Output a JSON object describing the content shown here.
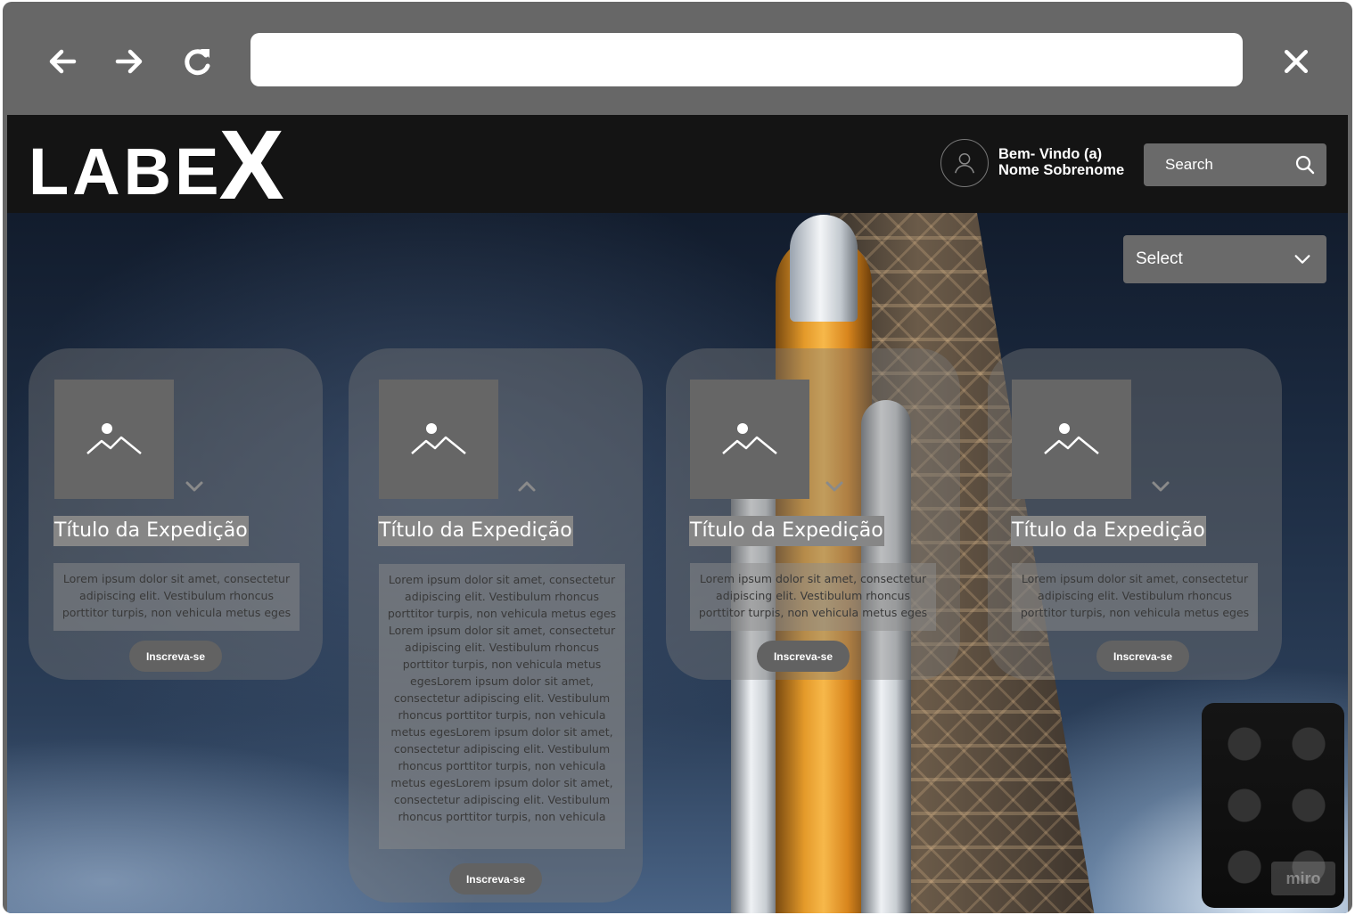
{
  "browser": {
    "url_value": "",
    "icons": {
      "back": "arrow-left-icon",
      "forward": "arrow-right-icon",
      "reload": "reload-icon",
      "close": "close-icon"
    }
  },
  "header": {
    "logo_main": "LABE",
    "logo_accent": "X",
    "welcome_line1": "Bem- Vindo (a)",
    "welcome_line2": "Nome Sobrenome",
    "search_placeholder": "Search"
  },
  "filter": {
    "select_label": "Select"
  },
  "cards": [
    {
      "title": "Título da Expedição",
      "caret": "down",
      "description": "Lorem ipsum dolor sit amet, consectetur adipiscing elit. Vestibulum rhoncus porttitor turpis, non vehicula metus eges",
      "button": "Inscreva-se"
    },
    {
      "title": "Título da Expedição",
      "caret": "up",
      "description": "Lorem ipsum dolor sit amet, consectetur adipiscing elit. Vestibulum rhoncus porttitor turpis, non vehicula metus eges Lorem ipsum dolor sit amet, consectetur adipiscing elit. Vestibulum rhoncus porttitor turpis, non vehicula metus egesLorem ipsum dolor sit amet, consectetur adipiscing elit. Vestibulum rhoncus porttitor turpis, non vehicula metus egesLorem ipsum dolor sit amet, consectetur adipiscing elit. Vestibulum rhoncus porttitor turpis, non vehicula metus egesLorem ipsum dolor sit amet, consectetur adipiscing elit. Vestibulum rhoncus porttitor turpis, non vehicula",
      "button": "Inscreva-se"
    },
    {
      "title": "Título da Expedição",
      "caret": "down",
      "description": "Lorem ipsum dolor sit amet, consectetur adipiscing elit. Vestibulum rhoncus porttitor turpis, non vehicula metus eges",
      "button": "Inscreva-se"
    },
    {
      "title": "Título da Expedição",
      "caret": "down",
      "description": "Lorem ipsum dolor sit amet, consectetur adipiscing elit. Vestibulum rhoncus porttitor turpis, non vehicula metus eges",
      "button": "Inscreva-se"
    }
  ],
  "watermark": "miro",
  "colors": {
    "frame": "#676767",
    "header": "#141414",
    "control": "#6a6a6a",
    "button": "#626262"
  }
}
